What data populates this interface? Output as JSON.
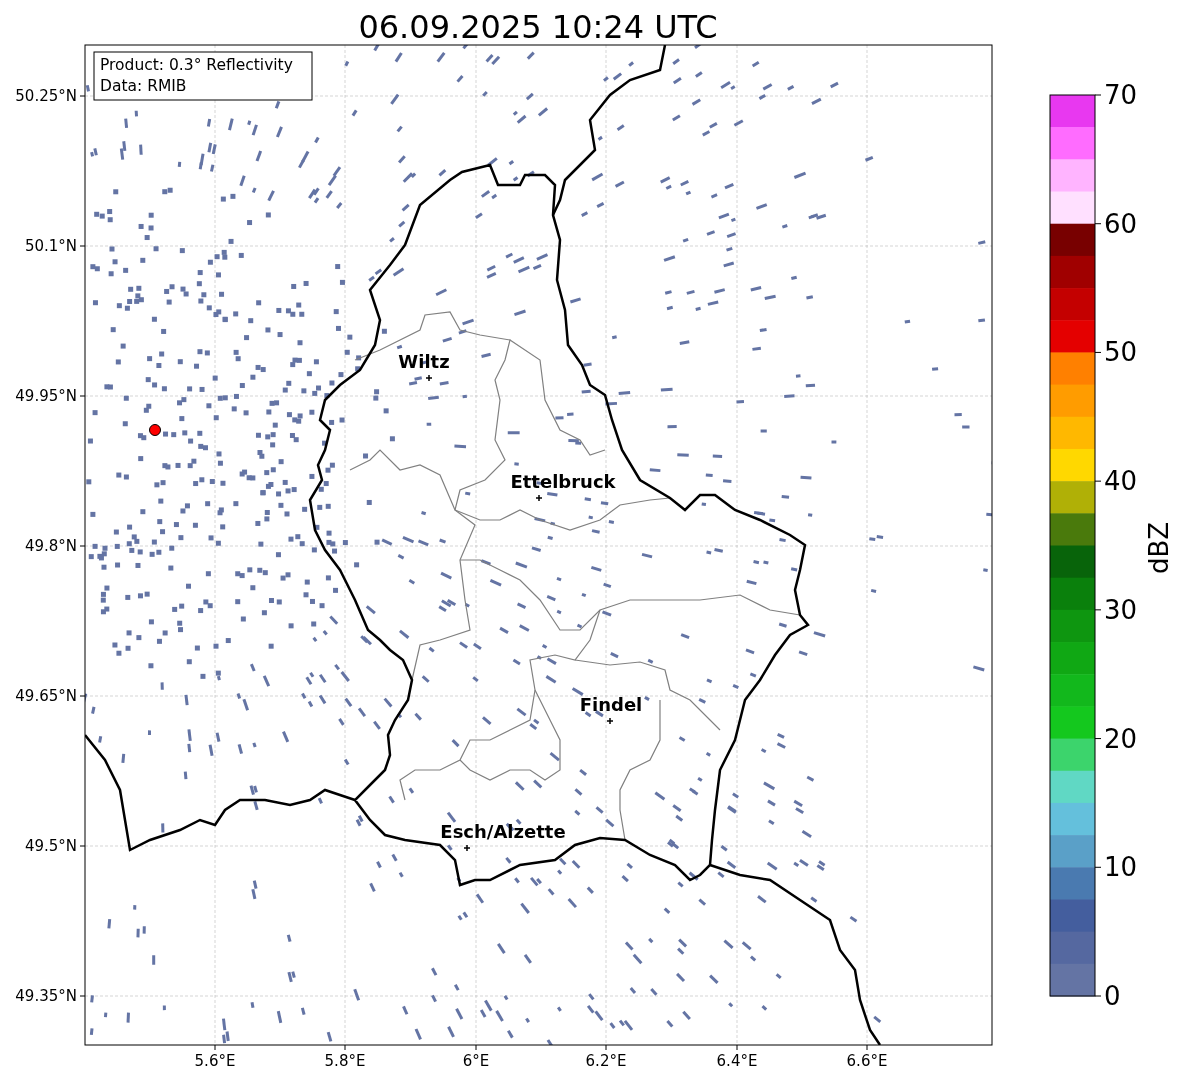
{
  "title": "06.09.2025 10:24 UTC",
  "info_box": [
    "Product: 0.3° Reflectivity",
    "Data: RMIB"
  ],
  "lat_ticks": [
    "50.25°N",
    "50.1°N",
    "49.95°N",
    "49.8°N",
    "49.65°N",
    "49.5°N",
    "49.35°N"
  ],
  "lon_ticks": [
    "5.6°E",
    "5.8°E",
    "6°E",
    "6.2°E",
    "6.4°E",
    "6.6°E"
  ],
  "cities": [
    {
      "name": "Wiltz"
    },
    {
      "name": "Ettelbruck"
    },
    {
      "name": "Findel"
    },
    {
      "name": "Esch/Alzette"
    }
  ],
  "colorbar": {
    "label": "dBZ",
    "ticks": [
      "70",
      "60",
      "50",
      "40",
      "30",
      "20",
      "10",
      "0"
    ],
    "bands": [
      {
        "color": "#e838f0"
      },
      {
        "color": "#ff6cff"
      },
      {
        "color": "#ffb4ff"
      },
      {
        "color": "#ffe0ff"
      },
      {
        "color": "#780000"
      },
      {
        "color": "#a00000"
      },
      {
        "color": "#c40000"
      },
      {
        "color": "#e40000"
      },
      {
        "color": "#ff8000"
      },
      {
        "color": "#ff9c00"
      },
      {
        "color": "#ffb800"
      },
      {
        "color": "#ffd800"
      },
      {
        "color": "#b0b006"
      },
      {
        "color": "#4a7a0c"
      },
      {
        "color": "#08640a"
      },
      {
        "color": "#0a800c"
      },
      {
        "color": "#0e9610"
      },
      {
        "color": "#10a814"
      },
      {
        "color": "#12b81c"
      },
      {
        "color": "#14c81e"
      },
      {
        "color": "#3cd46c"
      },
      {
        "color": "#60d8c4"
      },
      {
        "color": "#64c0dc"
      },
      {
        "color": "#5aa0c8"
      },
      {
        "color": "#4a7ab0"
      },
      {
        "color": "#445e9e"
      },
      {
        "color": "#5568a0"
      },
      {
        "color": "#6474a4"
      }
    ]
  }
}
